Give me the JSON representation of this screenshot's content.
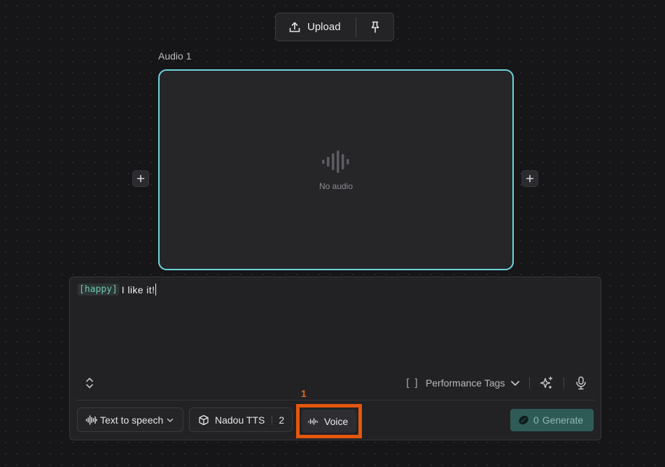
{
  "toolbar": {
    "upload_label": "Upload"
  },
  "audio": {
    "label": "Audio 1",
    "empty_text": "No audio"
  },
  "prompt": {
    "tag": "[happy]",
    "text": "I like it!"
  },
  "performance_tags": {
    "label": "Performance Tags"
  },
  "bottom_bar": {
    "mode_label": "Text to speech",
    "model_label": "Nadou TTS",
    "model_count": "2",
    "voice_label": "Voice",
    "generate_count": "0",
    "generate_label": "Generate"
  },
  "annotation": {
    "number": "1"
  },
  "colors": {
    "accent_border": "#6fd6dc",
    "tag_text": "#69c9b2",
    "highlight": "#e4560f",
    "generate_bg": "#2f5b57"
  }
}
